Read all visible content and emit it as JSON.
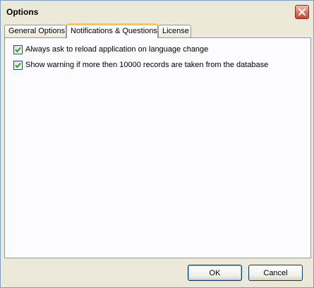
{
  "window": {
    "title": "Options"
  },
  "tabs": [
    {
      "label": "General Options",
      "active": false
    },
    {
      "label": "Notifications & Questions",
      "active": true
    },
    {
      "label": "License",
      "active": false
    }
  ],
  "options": [
    {
      "label": "Always ask to reload application on language change",
      "checked": true
    },
    {
      "label": "Show warning if more then 10000 records are taken from the database",
      "checked": true
    }
  ],
  "buttons": {
    "ok": "OK",
    "cancel": "Cancel"
  },
  "colors": {
    "active_tab_accent": "#ffc83c",
    "close_button": "#c24a33",
    "checkbox_check": "#21a121"
  }
}
